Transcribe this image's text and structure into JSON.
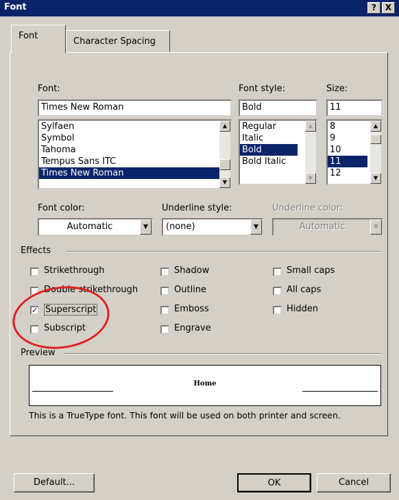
{
  "window": {
    "title": "Font",
    "help_label": "?",
    "close_label": "X"
  },
  "tabs": [
    {
      "label": "Font",
      "active": true
    },
    {
      "label": "Character Spacing",
      "active": false
    }
  ],
  "font": {
    "label": "Font:",
    "value": "Times New Roman",
    "items": [
      "Sylfaen",
      "Symbol",
      "Tahoma",
      "Tempus Sans ITC",
      "Times New Roman"
    ],
    "selected_index": 4
  },
  "font_style": {
    "label": "Font style:",
    "value": "Bold",
    "items": [
      "Regular",
      "Italic",
      "Bold",
      "Bold Italic"
    ],
    "selected_index": 2
  },
  "size": {
    "label": "Size:",
    "value": "11",
    "items": [
      "8",
      "9",
      "10",
      "11",
      "12"
    ],
    "selected_index": 3
  },
  "font_color": {
    "label": "Font color:",
    "value": "Automatic"
  },
  "underline_style": {
    "label": "Underline style:",
    "value": "(none)"
  },
  "underline_color": {
    "label": "Underline color:",
    "value": "Automatic",
    "disabled": true
  },
  "effects": {
    "label": "Effects",
    "options": [
      {
        "label": "Strikethrough",
        "checked": false
      },
      {
        "label": "Double strikethrough",
        "checked": false
      },
      {
        "label": "Superscript",
        "checked": true
      },
      {
        "label": "Subscript",
        "checked": false
      },
      {
        "label": "Shadow",
        "checked": false
      },
      {
        "label": "Outline",
        "checked": false
      },
      {
        "label": "Emboss",
        "checked": false
      },
      {
        "label": "Engrave",
        "checked": false
      },
      {
        "label": "Small caps",
        "checked": false
      },
      {
        "label": "All caps",
        "checked": false
      },
      {
        "label": "Hidden",
        "checked": false
      }
    ],
    "checkmark": "✓"
  },
  "preview": {
    "label": "Preview",
    "sample_text": "Home"
  },
  "info_text": "This is a TrueType font. This font will be used on both printer and screen.",
  "buttons": {
    "default": "Default...",
    "ok": "OK",
    "cancel": "Cancel"
  },
  "colors": {
    "titlebar": "#0a246a",
    "selection": "#0a246a",
    "face": "#d4d0c8",
    "annotation": "#e02020"
  }
}
